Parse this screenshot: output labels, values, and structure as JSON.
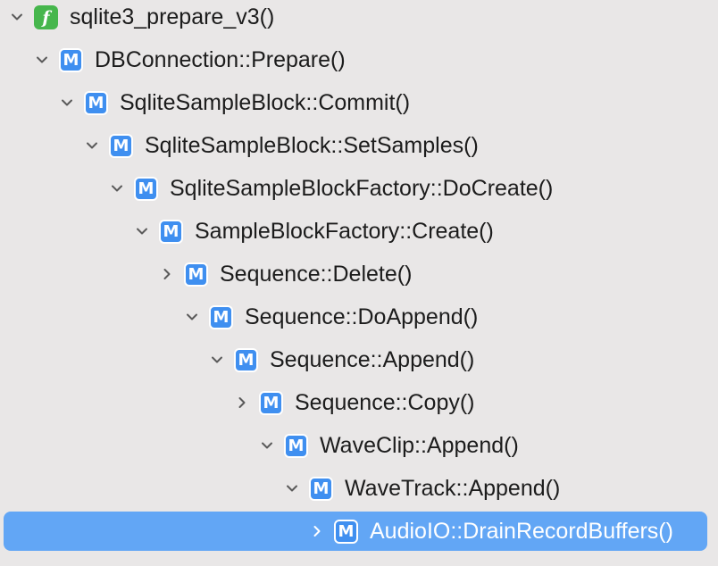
{
  "tree": {
    "rows": [
      {
        "label": "sqlite3_prepare_v3()",
        "icon": "function-icon",
        "icon_glyph": "f",
        "state": "expanded",
        "selected": false
      },
      {
        "label": "DBConnection::Prepare()",
        "icon": "method-icon",
        "icon_glyph": "M",
        "state": "expanded",
        "selected": false
      },
      {
        "label": "SqliteSampleBlock::Commit()",
        "icon": "method-icon",
        "icon_glyph": "M",
        "state": "expanded",
        "selected": false
      },
      {
        "label": "SqliteSampleBlock::SetSamples()",
        "icon": "method-icon",
        "icon_glyph": "M",
        "state": "expanded",
        "selected": false
      },
      {
        "label": "SqliteSampleBlockFactory::DoCreate()",
        "icon": "method-icon",
        "icon_glyph": "M",
        "state": "expanded",
        "selected": false
      },
      {
        "label": "SampleBlockFactory::Create()",
        "icon": "method-icon",
        "icon_glyph": "M",
        "state": "expanded",
        "selected": false
      },
      {
        "label": "Sequence::Delete()",
        "icon": "method-icon",
        "icon_glyph": "M",
        "state": "collapsed",
        "selected": false
      },
      {
        "label": "Sequence::DoAppend()",
        "icon": "method-icon",
        "icon_glyph": "M",
        "state": "expanded",
        "selected": false
      },
      {
        "label": "Sequence::Append()",
        "icon": "method-icon",
        "icon_glyph": "M",
        "state": "expanded",
        "selected": false
      },
      {
        "label": "Sequence::Copy()",
        "icon": "method-icon",
        "icon_glyph": "M",
        "state": "collapsed",
        "selected": false
      },
      {
        "label": "WaveClip::Append()",
        "icon": "method-icon",
        "icon_glyph": "M",
        "state": "expanded",
        "selected": false
      },
      {
        "label": "WaveTrack::Append()",
        "icon": "method-icon",
        "icon_glyph": "M",
        "state": "expanded",
        "selected": false
      },
      {
        "label": "AudioIO::DrainRecordBuffers()",
        "icon": "method-icon",
        "icon_glyph": "M",
        "state": "collapsed",
        "selected": true
      }
    ]
  },
  "colors": {
    "background": "#e9e7e7",
    "selection": "#62a6f5",
    "method_icon": "#3f8ff0",
    "function_icon": "#46b64c"
  }
}
